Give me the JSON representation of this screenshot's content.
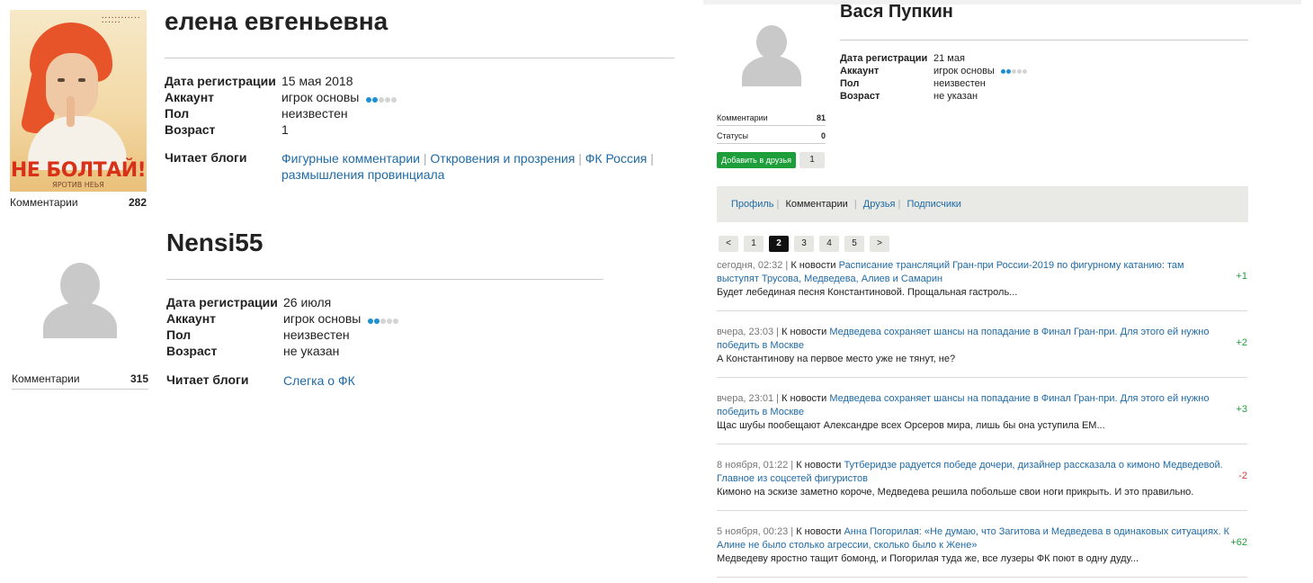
{
  "left": {
    "users": [
      {
        "name": "елена евгеньевна",
        "avatar": "poster-avatar",
        "poster": {
          "headline": "НЕ БОЛТАЙ!",
          "footer": "ЯРОТИВ НЕЬЯ"
        },
        "comments_label": "Комментарии",
        "comments_count": "282",
        "fields": [
          {
            "label": "Дата регистрации",
            "value": "15 мая 2018"
          },
          {
            "label": "Аккаунт",
            "value": "игрок основы"
          },
          {
            "label": "Пол",
            "value": "неизвестен"
          },
          {
            "label": "Возраст",
            "value": "1"
          }
        ],
        "blogs_label": "Читает блоги",
        "blogs": [
          "Фигурные комментарии",
          "Откровения и прозрения",
          "ФК Россия",
          "размышления провинциала"
        ]
      },
      {
        "name": "Nensi55",
        "avatar": "default-avatar",
        "comments_label": "Комментарии",
        "comments_count": "315",
        "fields": [
          {
            "label": "Дата регистрации",
            "value": "26 июля"
          },
          {
            "label": "Аккаунт",
            "value": "игрок основы"
          },
          {
            "label": "Пол",
            "value": "неизвестен"
          },
          {
            "label": "Возраст",
            "value": "не указан"
          }
        ],
        "blogs_label": "Читает блоги",
        "blogs": [
          "Слегка о ФК"
        ]
      }
    ]
  },
  "right": {
    "name": "Вася Пупкин",
    "fields": [
      {
        "label": "Дата регистрации",
        "value": "21 мая"
      },
      {
        "label": "Аккаунт",
        "value": "игрок основы"
      },
      {
        "label": "Пол",
        "value": "неизвестен"
      },
      {
        "label": "Возраст",
        "value": "не указан"
      }
    ],
    "stats": [
      {
        "label": "Комментарии",
        "value": "81"
      },
      {
        "label": "Статусы",
        "value": "0"
      }
    ],
    "add_friend": "Добавить в друзья",
    "friend_count": "1",
    "tabs": [
      "Профиль",
      "Комментарии",
      "Друзья",
      "Подписчики"
    ],
    "active_tab": "Комментарии",
    "pager": [
      "<",
      "1",
      "2",
      "3",
      "4",
      "5",
      ">"
    ],
    "current_page": "2",
    "comments": [
      {
        "time": "сегодня, 02:32",
        "prefix": "К новости",
        "title": "Расписание трансляций Гран-при России-2019 по фигурному катанию: там выступят Трусова, Медведева, Алиев и Самарин",
        "text": "Будет лебединая песня Константиновой. Прощальная гастроль...",
        "score": "+1"
      },
      {
        "time": "вчера, 23:03",
        "prefix": "К новости",
        "title": "Медведева сохраняет шансы на попадание в Финал Гран-при. Для этого ей нужно победить в Москве",
        "text": "А Константинову на первое место уже не тянут, не?",
        "score": "+2"
      },
      {
        "time": "вчера, 23:01",
        "prefix": "К новости",
        "title": "Медведева сохраняет шансы на попадание в Финал Гран-при. Для этого ей нужно победить в Москве",
        "text": "Щас шубы пообещают Александре всех Орсеров мира, лишь бы она уступила ЕМ...",
        "score": "+3"
      },
      {
        "time": "8 ноября, 01:22",
        "prefix": "К новости",
        "title": "Тутберидзе радуется победе дочери, дизайнер рассказала о кимоно Медведевой. Главное из соцсетей фигуристов",
        "text": "Кимоно на эскизе заметно короче, Медведева решила побольше свои ноги прикрыть. И это правильно.",
        "score": "-2"
      },
      {
        "time": "5 ноября, 00:23",
        "prefix": "К новости",
        "title": "Анна Погорилая: «Не думаю, что Загитова и Медведева в одинаковых ситуациях. К Алине не было столько агрессии, сколько было к Жене»",
        "text": "Медведеву яростно тащит бомонд, и Погорилая туда же, все лузеры ФК поют в одну дуду...",
        "score": "+62"
      }
    ]
  },
  "colors": {
    "link": "#1f6aa5",
    "positive": "#1e9e3a",
    "negative": "#d23a3a",
    "dot_active": "#1e8fd0",
    "button": "#1e9e3a"
  }
}
